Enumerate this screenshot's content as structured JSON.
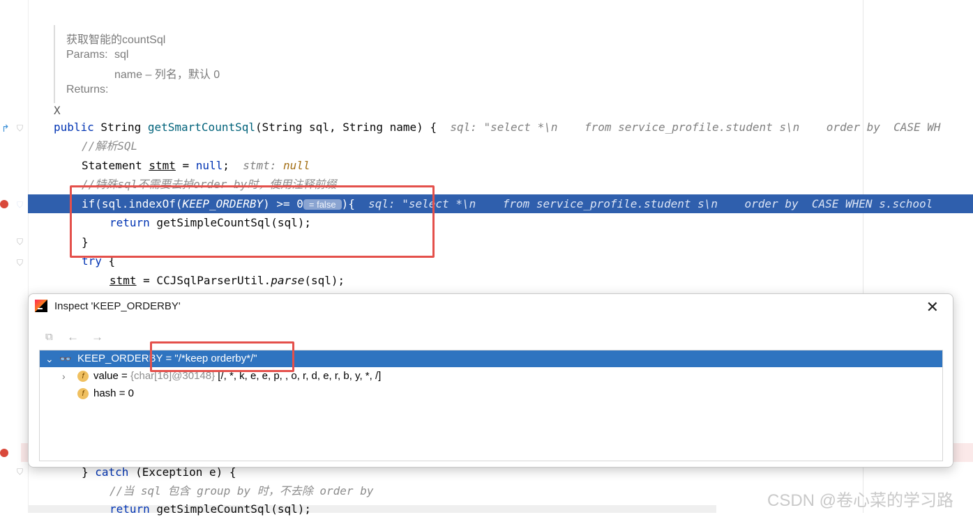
{
  "doc": {
    "summary": "获取智能的countSql",
    "params_label": "Params:",
    "param1": "sql",
    "param2": "name – 列名，默认 0",
    "returns_label": "Returns:",
    "stray": "X"
  },
  "code": {
    "l1_kw": "public",
    "l1_type": " String ",
    "l1_fn": "getSmartCountSql",
    "l1_rest": "(String sql, String name) {",
    "l1_hint": "  sql: \"select *\\n    from service_profile.student s\\n    order by  CASE WH",
    "l2_comment": "//解析SQL",
    "l3_a": "Statement ",
    "l3_var": "stmt",
    "l3_b": " = ",
    "l3_null": "null",
    "l3_c": ";",
    "l3_hint": "  stmt: ",
    "l3_hint_val": "null",
    "l4_comment": "//特殊sql不需要去掉order by时，使用注释前缀",
    "l5_a": "if(sql.indexOf(",
    "l5_const": "KEEP_ORDERBY",
    "l5_b": ") >= 0",
    "l5_badge": "= false",
    "l5_c": "){",
    "l5_hint": "  sql: \"select *\\n    from service_profile.student s\\n    order by  CASE WHEN s.school",
    "l6_kw": "return",
    "l6_rest": " getSimpleCountSql(sql);",
    "l7": "}",
    "l8_kw": "try",
    "l8_rest": " {",
    "l9_var": "stmt",
    "l9_a": " = CCJSqlParserUtil.",
    "l9_fn": "parse",
    "l9_b": "(sql);",
    "l10_a": "} ",
    "l10_kw": "catch",
    "l10_b": " (Exception e) {",
    "l11_comment": "//当 sql 包含 group by 时，不去除 order by",
    "l12_kw": "return",
    "l12_rest": " getSimpleCountSql(sql);"
  },
  "popup": {
    "title": "Inspect 'KEEP_ORDERBY'",
    "close": "✕",
    "back": "←",
    "forward": "→",
    "rows": [
      {
        "name": "KEEP_ORDERBY",
        "eq": " = ",
        "value": "\"/*keep orderby*/\""
      },
      {
        "name": "value",
        "eq": " = ",
        "type": "{char[16]@30148}",
        "value": " [/, *, k, e, e, p,  , o, r, d, e, r, b, y, *, /]"
      },
      {
        "name": "hash",
        "eq": " = ",
        "value": "0"
      }
    ]
  },
  "watermark": "CSDN @卷心菜的学习路"
}
